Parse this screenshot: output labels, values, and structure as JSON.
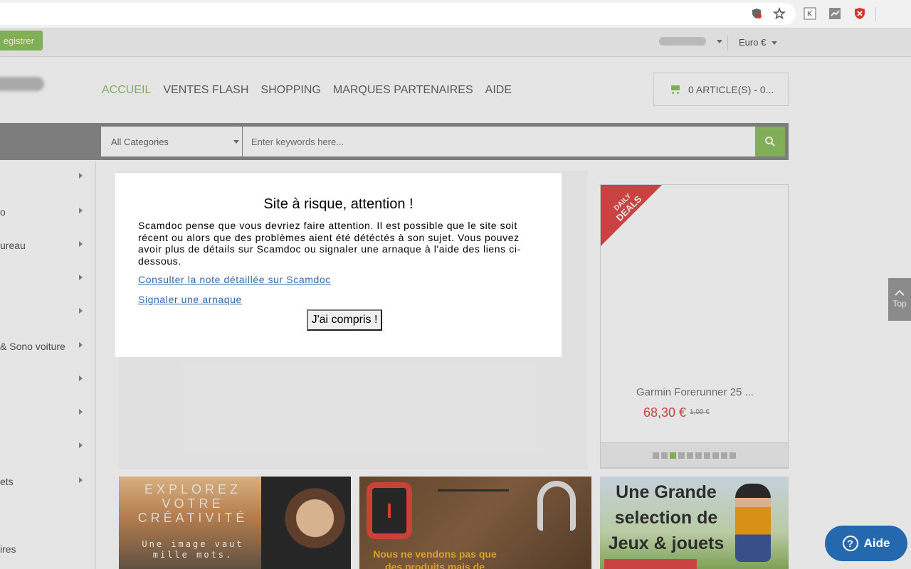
{
  "topbar": {
    "register_label": "egistrer",
    "currency": "Euro €"
  },
  "nav": {
    "items": [
      "ACCUEIL",
      "VENTES FLASH",
      "SHOPPING",
      "MARQUES PARTENAIRES",
      "AIDE"
    ],
    "active_color": "#8fc363"
  },
  "cart": {
    "label": "0 ARTICLE(S) - 0..."
  },
  "search": {
    "category": "All Categories",
    "placeholder": "Enter keywords here..."
  },
  "sidebar": {
    "items": [
      "",
      "o",
      "ureau",
      "",
      "",
      "& Sono voiture",
      "",
      "",
      "",
      "ets",
      "",
      "ires"
    ]
  },
  "deal": {
    "ribbon_top": "DAILY",
    "ribbon_bottom": "DEALS",
    "name": "Garmin Forerunner 25 ...",
    "price": "68,30 €",
    "old_price": "1,00 €",
    "dots_total": 10,
    "dots_active_index": 3,
    "accent_color": "#e34a4a"
  },
  "banners": {
    "b1_title": "EXPLOREZ VOTRE CRÉATIVITÉ",
    "b1_subtitle": "Une image vaut mille mots.",
    "b2_text": "Nous ne vendons pas que des produits mais de",
    "b3_text": "Une Grande selection de Jeux & jouets"
  },
  "back_to_top": "Top",
  "modal": {
    "title": "Site à risque, attention !",
    "body": "Scamdoc pense que vous devriez faire attention. Il est possible que le site soit récent ou alors que des problèmes aient été détéctés à son sujet. Vous pouvez avoir plus de détails sur Scamdoc ou signaler une arnaque à l'aide des liens ci-dessous.",
    "link_details": "Consulter la note détaillée sur Scamdoc",
    "link_report": "Signaler une arnaque",
    "ok_button": "J'ai compris !"
  },
  "help": {
    "label": "Aide"
  }
}
